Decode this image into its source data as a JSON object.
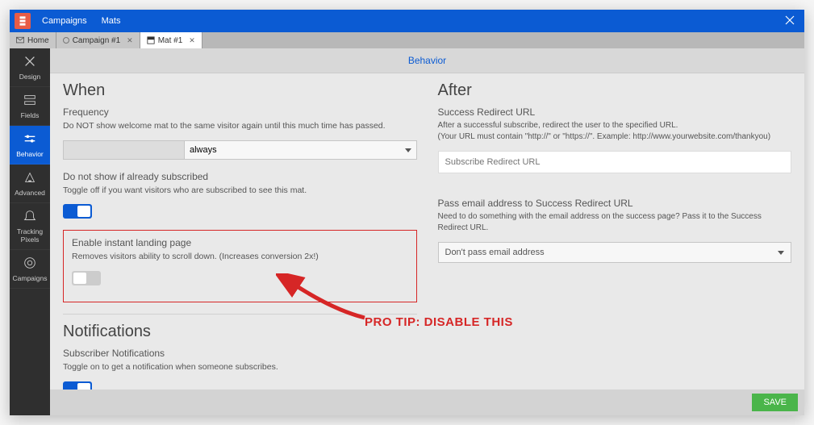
{
  "titlebar": {
    "menu": [
      "Campaigns",
      "Mats"
    ]
  },
  "tabs": [
    {
      "label": "Home",
      "icon": "mail"
    },
    {
      "label": "Campaign #1",
      "icon": "dot"
    },
    {
      "label": "Mat #1",
      "icon": "mat",
      "active": true
    }
  ],
  "sidebar": [
    {
      "label": "Design",
      "icon": "design"
    },
    {
      "label": "Fields",
      "icon": "fields"
    },
    {
      "label": "Behavior",
      "icon": "behavior",
      "active": true
    },
    {
      "label": "Advanced",
      "icon": "advanced"
    },
    {
      "label": "Tracking Pixels",
      "icon": "tracking"
    },
    {
      "label": "Campaigns",
      "icon": "campaigns"
    }
  ],
  "content": {
    "header": "Behavior",
    "when": {
      "title": "When",
      "frequency": {
        "label": "Frequency",
        "help": "Do NOT show welcome mat to the same visitor again until this much time has passed.",
        "value": "always"
      },
      "subscribed": {
        "label": "Do not show if already subscribed",
        "help": "Toggle off if you want visitors who are subscribed to see this mat."
      },
      "instant": {
        "label": "Enable instant landing page",
        "help": "Removes visitors ability to scroll down. (Increases conversion 2x!)"
      }
    },
    "after": {
      "title": "After",
      "redirect": {
        "label": "Success Redirect URL",
        "help1": "After a successful subscribe, redirect the user to the specified URL.",
        "help2": "(Your URL must contain \"http://\" or \"https://\". Example: http://www.yourwebsite.com/thankyou)",
        "placeholder": "Subscribe Redirect URL"
      },
      "pass": {
        "label": "Pass email address to Success Redirect URL",
        "help": "Need to do something with the email address on the success page? Pass it to the Success Redirect URL.",
        "value": "Don't pass email address"
      }
    },
    "notifications": {
      "title": "Notifications",
      "sub": {
        "label": "Subscriber Notifications",
        "help": "Toggle on to get a notification when someone subscribes."
      }
    },
    "save": "SAVE"
  },
  "annotation": {
    "text": "PRO TIP: DISABLE THIS"
  }
}
